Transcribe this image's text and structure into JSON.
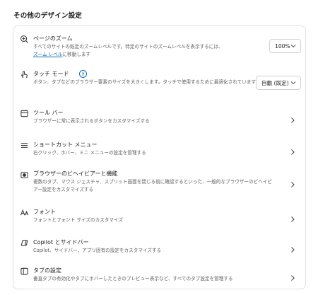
{
  "section_title": "その他のデザイン設定",
  "items": [
    {
      "icon": "zoom-icon",
      "title": "ページのズーム",
      "desc": "すべてのサイトの既定のズームレベルです。特定のサイトのズームレベルを表示するには、",
      "link": "ズーム レベル",
      "desc_after": "に移動します",
      "control": "100%"
    },
    {
      "icon": "touch-icon",
      "title": "タッチ モード",
      "help": "?",
      "desc": "ボタン、タブなどのブラウザー要素のサイズを大きくします。タッチで使用するために最適化されています",
      "control": "自動 (既定)"
    },
    {
      "icon": "toolbar-icon",
      "title": "ツール バー",
      "desc": "ブラウザーに常に表示されるボタンをカスタマイズする"
    },
    {
      "icon": "menu-icon",
      "title": "ショートカット メニュー",
      "desc": "右クリック、ホバー、ミニ メニューの設定を管理する"
    },
    {
      "icon": "browser-behavior-icon",
      "title": "ブラウザーのビヘイビアーと機能",
      "desc": "複数のタブ、マウス ジェスチャ、スプリット画面を閉じる前に確認するといった、一般的なブラウザーのビヘイビアー設定をカスタマイズする"
    },
    {
      "icon": "font-icon",
      "title": "フォント",
      "desc": "フォントとフォント サイズのカスタマイズ"
    },
    {
      "icon": "copilot-icon",
      "title": "Copilot とサイドバー",
      "desc": "Copilot、サイドバー、アプリ固有の設定をカスタマイズする"
    },
    {
      "icon": "tab-icon",
      "title": "タブの設定",
      "desc": "垂直タブの有効化やタブにホバーしたときのプレビュー表示など、すべてのタブ設定を管理する"
    }
  ]
}
